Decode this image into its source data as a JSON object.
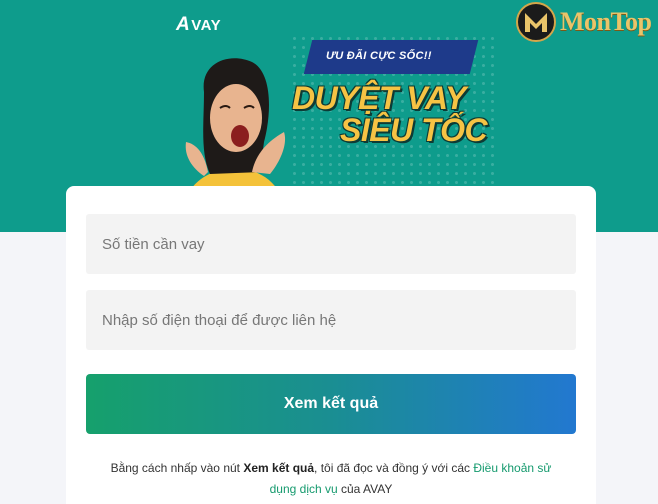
{
  "hero": {
    "logo_text": "VAY",
    "logo_mark": "A",
    "badge_text": "MonTop",
    "promo_tag": "ƯU ĐÃI CỰC SỐC!!",
    "promo_line1": "DUYỆT VAY",
    "promo_line2": "SIÊU TỐC",
    "bg_color": "#0e9c8c"
  },
  "form": {
    "amount_placeholder": "Số tiền cần vay",
    "phone_placeholder": "Nhập số điện thoại để được liên hệ",
    "submit_label": "Xem kết quả"
  },
  "terms": {
    "prefix": "Bằng cách nhấp vào nút ",
    "button_ref": "Xem kết quả",
    "middle": ", tôi đã đọc và đồng ý với các ",
    "link_text": "Điều khoản sử dụng dịch vụ",
    "suffix": " của AVAY"
  }
}
